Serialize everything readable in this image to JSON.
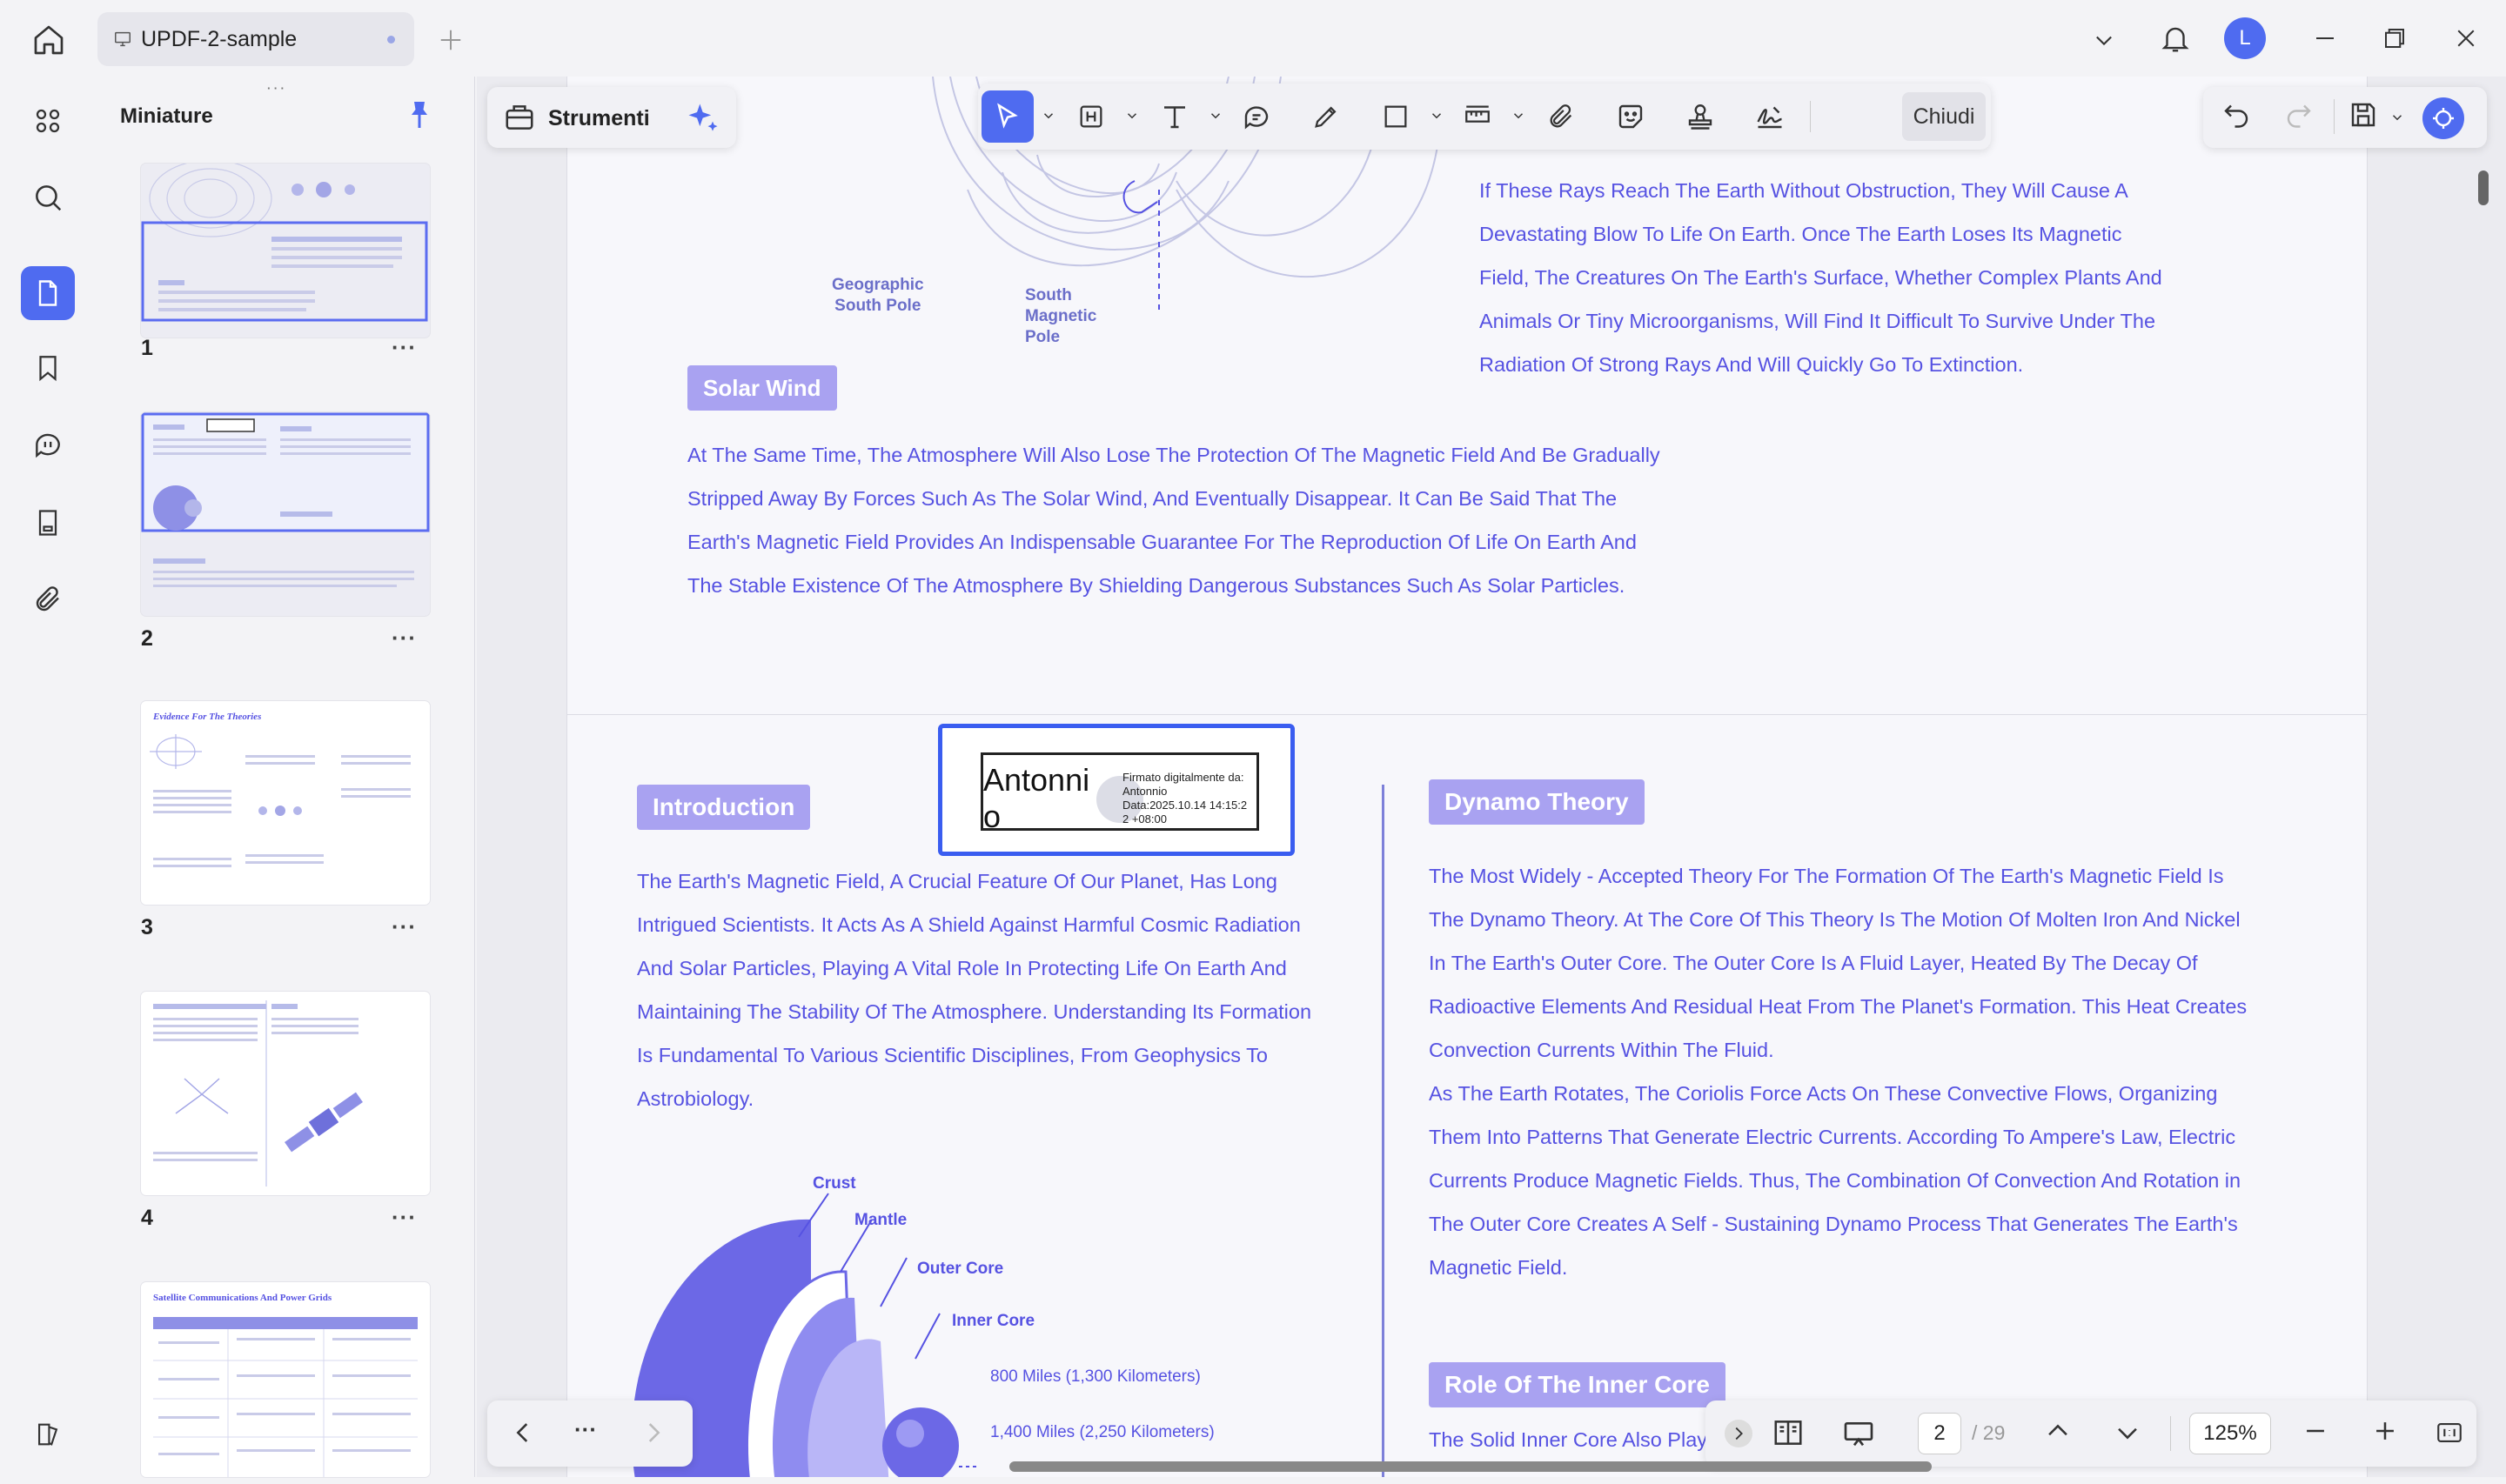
{
  "titlebar": {
    "tab_title": "UPDF-2-sample",
    "avatar_letter": "L"
  },
  "thumbs_panel": {
    "title": "Miniature",
    "pages": [
      "1",
      "2",
      "3",
      "4"
    ],
    "more_label": "···",
    "thumb3_title": "Evidence For The Theories",
    "thumb5_title": "Satellite Communications And Power Grids"
  },
  "toolbar": {
    "strumenti": "Strumenti",
    "chiudi": "Chiudi"
  },
  "page1": {
    "south_geo": "Geographic\nSouth Pole",
    "south_mag": "South\nMagnetic\nPole",
    "rays_lines": [
      "If These Rays Reach The Earth Without Obstruction, They Will Cause A",
      "Devastating Blow To Life On Earth. Once The Earth Loses Its Magnetic",
      "Field, The Creatures On The Earth's Surface, Whether Complex Plants And",
      "Animals Or Tiny Microorganisms, Will Find It Difficult To Survive Under The",
      "Radiation Of Strong Rays And Will Quickly Go To Extinction."
    ],
    "solar_wind_heading": "Solar Wind",
    "solar_wind_lines": [
      "At The Same Time, The Atmosphere Will Also Lose The Protection Of The Magnetic Field And Be Gradually",
      "Stripped Away By Forces Such As The Solar Wind, And Eventually Disappear. It Can Be Said That The",
      "Earth's Magnetic Field Provides An Indispensable Guarantee For The Reproduction Of Life On Earth And",
      "The Stable Existence Of The Atmosphere By Shielding Dangerous Substances Such As Solar Particles."
    ]
  },
  "page2": {
    "intro_heading": "Introduction",
    "intro_lines": [
      "The Earth's Magnetic Field, A Crucial Feature Of Our Planet, Has Long",
      "Intrigued Scientists. It Acts As A Shield Against Harmful Cosmic Radiation",
      "And Solar Particles, Playing A Vital Role In Protecting Life On Earth And",
      "Maintaining The Stability Of The Atmosphere. Understanding Its Formation",
      "Is Fundamental To Various Scientific Disciplines, From Geophysics To",
      "Astrobiology."
    ],
    "signature": {
      "name_line1": "Antonni",
      "name_line2": "o",
      "detail_lines": [
        "Firmato digitalmente da:",
        "Antonnio",
        "Data:2025.10.14 14:15:2",
        "2 +08:00"
      ]
    },
    "diagram_labels": {
      "crust": "Crust",
      "mantle": "Mantle",
      "outer_core": "Outer Core",
      "inner_core": "Inner Core",
      "dist1": "800 Miles (1,300 Kilometers)",
      "dist2": "1,400 Miles (2,250 Kilometers)"
    },
    "dynamo_heading": "Dynamo Theory",
    "dynamo_lines": [
      "The Most Widely - Accepted Theory For The Formation Of The Earth's Magnetic Field Is",
      "The Dynamo Theory. At The Core Of This Theory Is The Motion Of Molten Iron And Nickel",
      "In The Earth's Outer Core. The Outer Core Is A Fluid Layer, Heated By The Decay Of",
      "Radioactive Elements And Residual Heat From The Planet's Formation. This Heat Creates",
      "Convection Currents Within The Fluid.",
      "As The Earth Rotates, The Coriolis Force Acts On These Convective Flows, Organizing",
      "Them Into Patterns That Generate Electric Currents. According To Ampere's Law, Electric",
      "Currents Produce Magnetic Fields. Thus, The Combination Of Convection And Rotation in",
      "The Outer Core Creates A Self - Sustaining Dynamo Process That Generates The Earth's",
      "Magnetic Field."
    ],
    "inner_core_heading": "Role Of The Inner Core",
    "inner_core_partial": "The Solid Inner Core Also Plays"
  },
  "nav": {
    "more": "···"
  },
  "zoom": {
    "current_page": "2",
    "total_pages": "/ 29",
    "zoom_level": "125%"
  },
  "colors": {
    "accent": "#4f6bf0",
    "doc_text": "#5652e2",
    "heading_bg": "#a9a2f1"
  }
}
